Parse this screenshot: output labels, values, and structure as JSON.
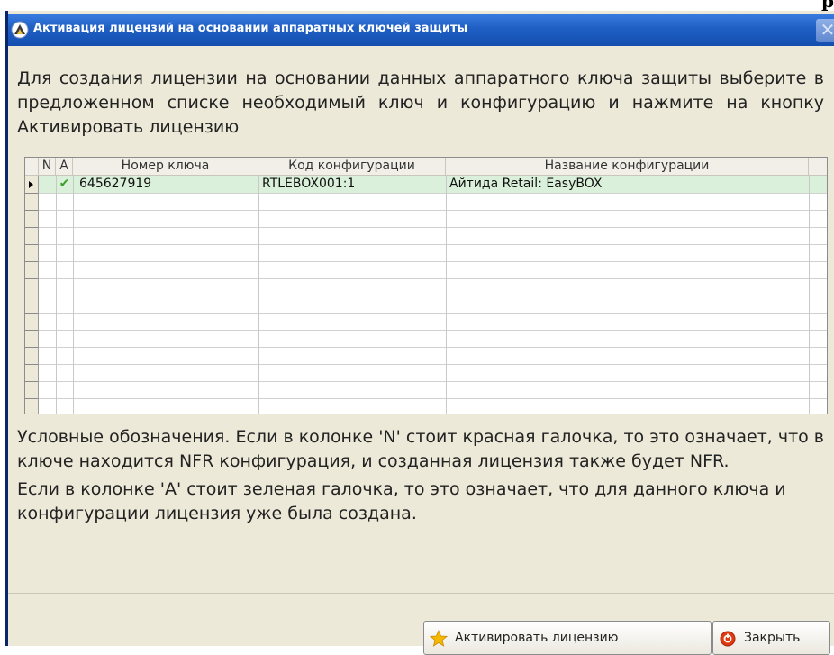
{
  "window": {
    "title": "Активация лицензий на основании аппаратных ключей защиты",
    "close_glyph": "✕",
    "top_fragment": "р",
    "app_icon": "app-icon"
  },
  "intro_text": "Для создания лицензии на основании данных аппаратного ключа защиты выберите в предложенном списке необходимый ключ и конфигурацию и нажмите на кнопку Активировать лицензию",
  "table": {
    "columns": [
      "N",
      "A",
      "Номер ключа",
      "Код конфигурации",
      "Название конфигурации"
    ],
    "rows": [
      {
        "n": "",
        "a": "✔",
        "key_number": "645627919",
        "config_code": "RTLEBOX001:1",
        "config_name": "Айтида Retail: EasyBOX"
      }
    ],
    "selected_row_color": "#daf0da",
    "check_color": "#3aa02a"
  },
  "legend": {
    "paragraph1": "Условные обозначения. Если в колонке 'N' стоит красная галочка, то это означает, что в ключе находится NFR конфигурация, и созданная лицензия также будет NFR.",
    "paragraph2": "Если в колонке 'A' стоит зеленая галочка, то это означает, что для данного ключа и конфигурации лицензия уже была создана."
  },
  "buttons": {
    "activate_label": "Активировать лицензию",
    "activate_icon": "star-icon",
    "close_label": "Закрыть",
    "close_icon": "close-circle-icon"
  },
  "colors": {
    "titlebar": "#1f5fc4",
    "window_bg": "#ece9d8",
    "star": "#f5b800",
    "close_circle": "#e03a10"
  }
}
